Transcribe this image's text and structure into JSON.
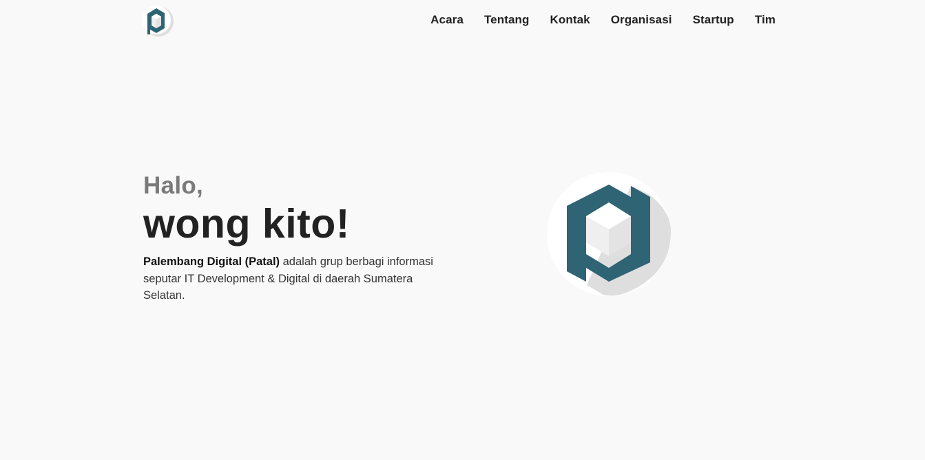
{
  "header": {
    "logo_icon": "patal-logo-icon",
    "nav": [
      {
        "label": "Acara"
      },
      {
        "label": "Tentang"
      },
      {
        "label": "Kontak"
      },
      {
        "label": "Organisasi"
      },
      {
        "label": "Startup"
      },
      {
        "label": "Tim"
      }
    ]
  },
  "hero": {
    "greeting": "Halo,",
    "headline": "wong kito!",
    "description_strong": "Palembang Digital (Patal)",
    "description_rest": " adalah grup berbagi informasi seputar IT Development & Digital di daerah Sumatera Selatan.",
    "logo_icon": "patal-logo-icon"
  },
  "colors": {
    "background": "#f9f9fa",
    "brand_teal": "#2e6474",
    "text_dark": "#222222",
    "text_grey": "#7a7a7a",
    "shadow_grey": "#dedede"
  }
}
